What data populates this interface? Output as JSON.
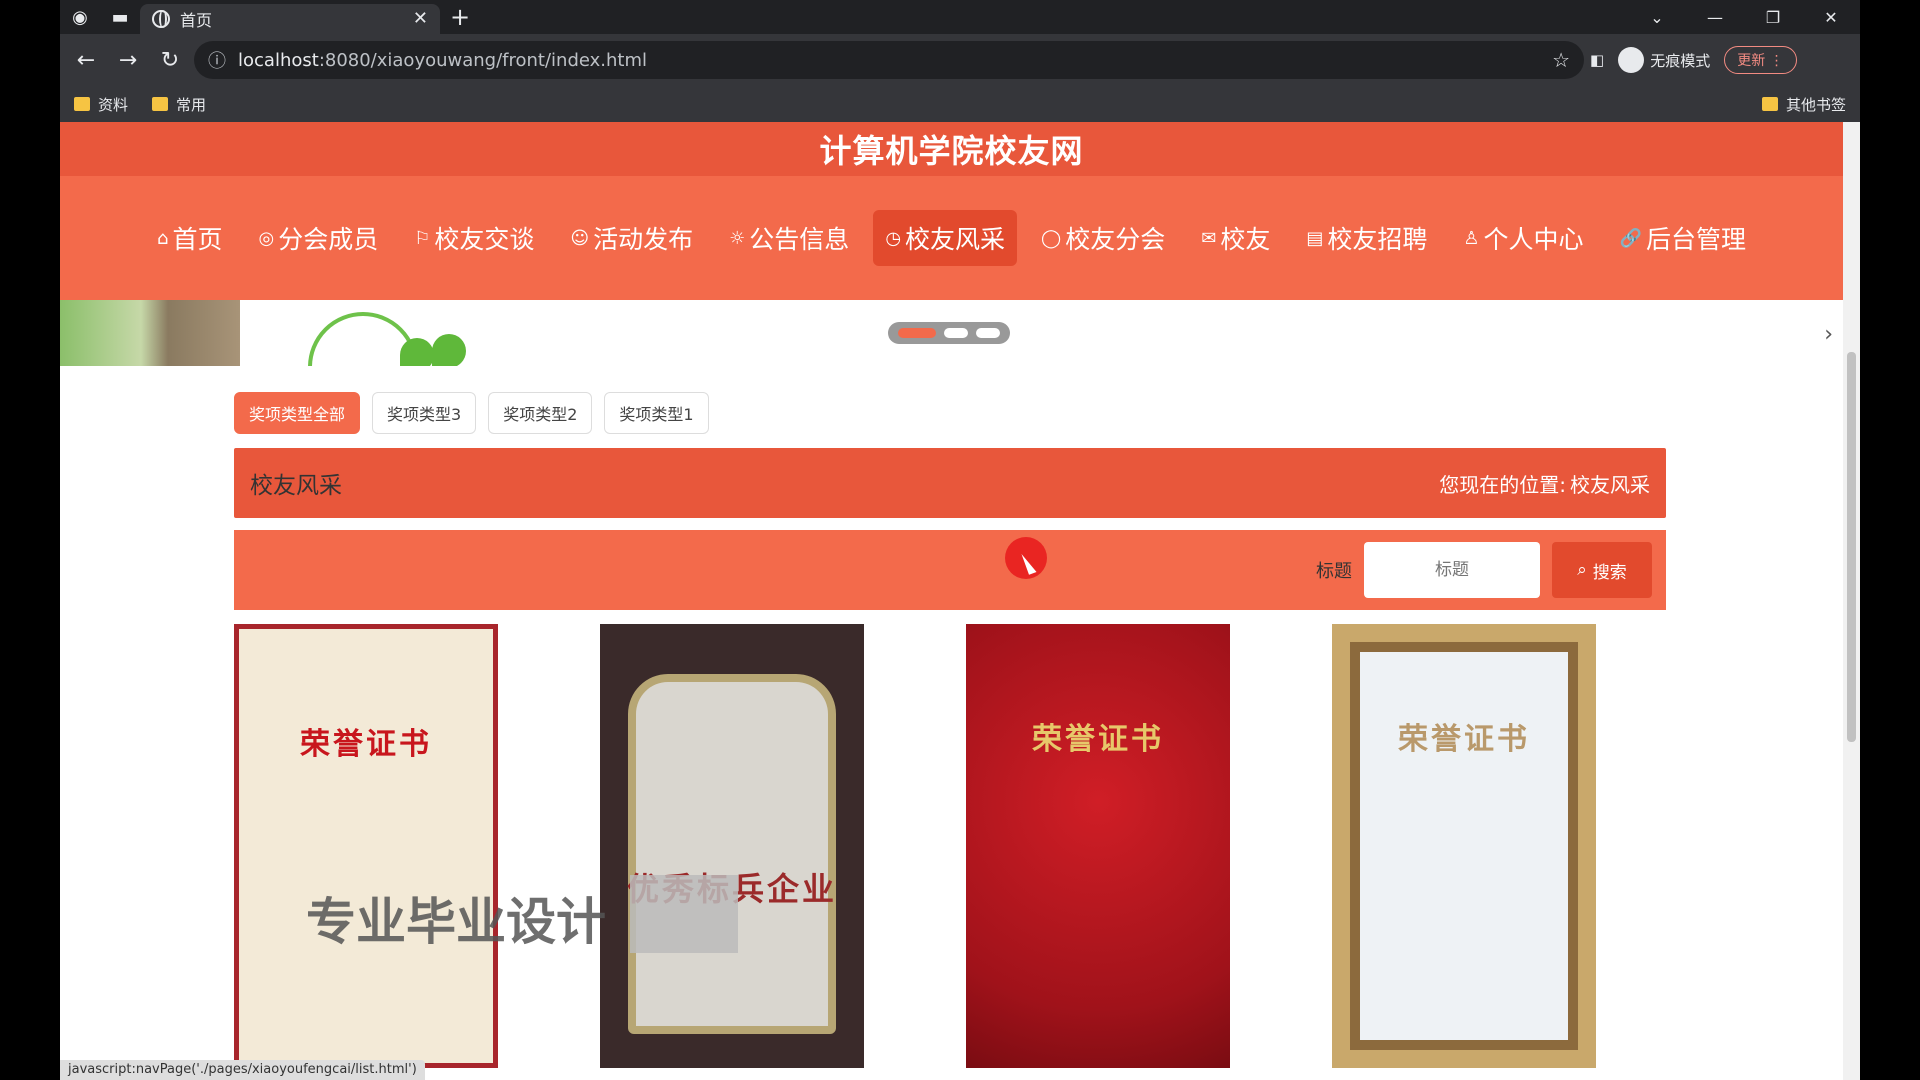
{
  "browser": {
    "tab_title": "首页",
    "close_glyph": "✕",
    "new_tab_glyph": "+",
    "url_host": "localhost",
    "url_rest": ":8080/xiaoyouwang/front/index.html",
    "incognito_label": "无痕模式",
    "update_label": "更新",
    "bookmarks": [
      "资料",
      "常用"
    ],
    "other_bookmarks": "其他书签",
    "status_url": "javascript:navPage('./pages/xiaoyoufengcai/list.html')"
  },
  "site": {
    "title": "计算机学院校友网",
    "nav": [
      {
        "icon": "⌂",
        "label": "首页"
      },
      {
        "icon": "◎",
        "label": "分会成员"
      },
      {
        "icon": "⚐",
        "label": "校友交谈"
      },
      {
        "icon": "☺",
        "label": "活动发布"
      },
      {
        "icon": "☼",
        "label": "公告信息"
      },
      {
        "icon": "◷",
        "label": "校友风采"
      },
      {
        "icon": "◯",
        "label": "校友分会"
      },
      {
        "icon": "✉",
        "label": "校友"
      },
      {
        "icon": "▤",
        "label": "校友招聘"
      },
      {
        "icon": "♙",
        "label": "个人中心"
      },
      {
        "icon": "🔗",
        "label": "后台管理"
      }
    ],
    "active_nav": "校友风采"
  },
  "filters": [
    "奖项类型全部",
    "奖项类型3",
    "奖项类型2",
    "奖项类型1"
  ],
  "section": {
    "title": "校友风采",
    "location_label": "您现在的位置:",
    "location_value": "校友风采"
  },
  "search": {
    "label": "标题",
    "placeholder": "标题",
    "button_label": "搜索"
  },
  "cards": [
    {
      "title": "荣誉证书"
    },
    {
      "title": "优秀标兵企业"
    },
    {
      "title": "荣誉证书"
    },
    {
      "title": "荣誉证书"
    }
  ],
  "overlay": {
    "watermark": "专业毕业设计"
  },
  "colors": {
    "primary": "#f36a4b",
    "primary_dark": "#e8573b"
  }
}
